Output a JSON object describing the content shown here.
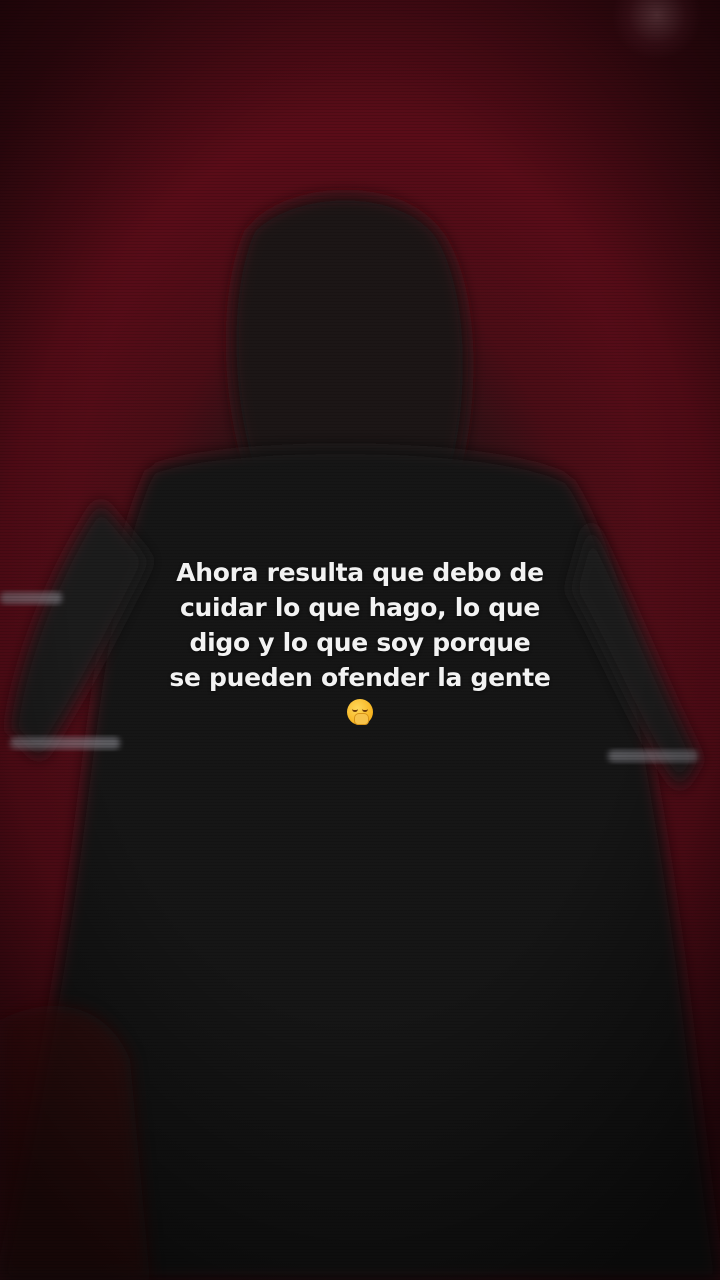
{
  "caption": {
    "lines": [
      "Ahora resulta que debo de",
      "cuidar lo que hago, lo que",
      "digo y lo que soy porque",
      "se pueden ofender la gente"
    ],
    "emoji": "yawning-face-icon"
  },
  "colors": {
    "background_red": "#5a0c18",
    "figure_dark": "#161616",
    "text": "#f2f2f2"
  }
}
